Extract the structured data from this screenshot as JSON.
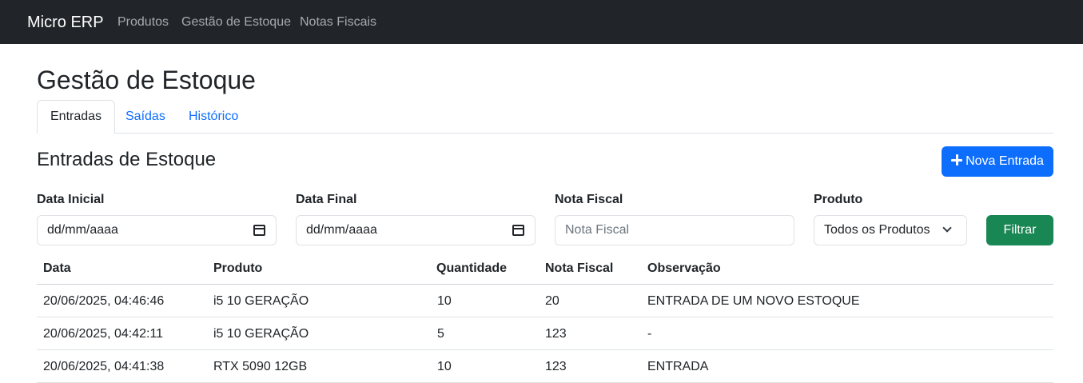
{
  "navbar": {
    "brand": "Micro ERP",
    "links": [
      "Produtos",
      "Gestão de Estoque",
      "Notas Fiscais"
    ]
  },
  "page": {
    "title": "Gestão de Estoque"
  },
  "tabs": [
    {
      "label": "Entradas",
      "active": true
    },
    {
      "label": "Saídas",
      "active": false
    },
    {
      "label": "Histórico",
      "active": false
    }
  ],
  "section": {
    "title": "Entradas de Estoque",
    "new_button": "Nova Entrada"
  },
  "filters": {
    "start_date": {
      "label": "Data Inicial",
      "value": "dd/mm/aaaa"
    },
    "end_date": {
      "label": "Data Final",
      "value": "dd/mm/aaaa"
    },
    "invoice": {
      "label": "Nota Fiscal",
      "placeholder": "Nota Fiscal"
    },
    "product": {
      "label": "Produto",
      "selected": "Todos os Produtos"
    },
    "filter_button": "Filtrar"
  },
  "table": {
    "columns": [
      "Data",
      "Produto",
      "Quantidade",
      "Nota Fiscal",
      "Observação"
    ],
    "rows": [
      [
        "20/06/2025, 04:46:46",
        "i5 10 GERAÇÃO",
        "10",
        "20",
        "ENTRADA DE UM NOVO ESTOQUE"
      ],
      [
        "20/06/2025, 04:42:11",
        "i5 10 GERAÇÃO",
        "5",
        "123",
        "-"
      ],
      [
        "20/06/2025, 04:41:38",
        "RTX 5090 12GB",
        "10",
        "123",
        "ENTRADA"
      ]
    ]
  },
  "colors": {
    "navbar": "#212529",
    "primary": "#0d6efd",
    "success": "#198754",
    "border": "#dee2e6"
  }
}
